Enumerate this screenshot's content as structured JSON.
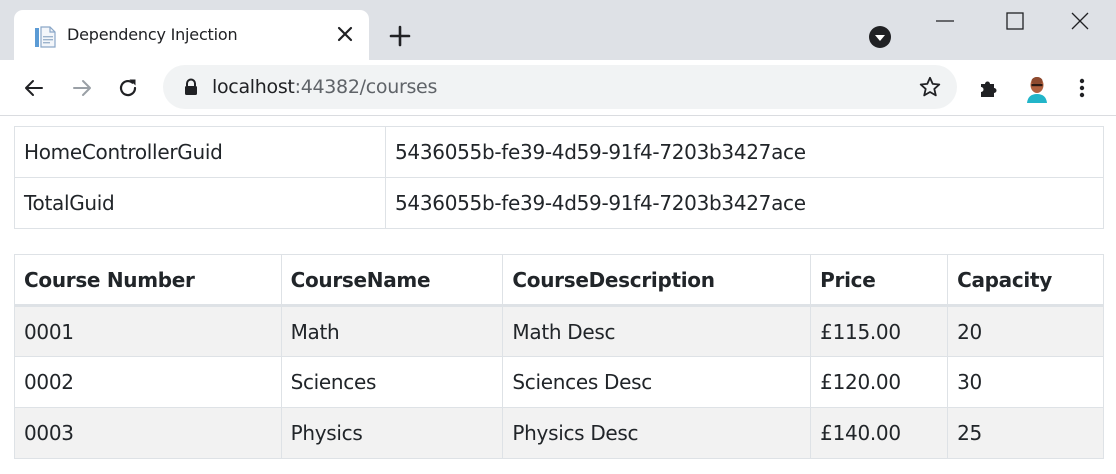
{
  "browser": {
    "tab_title": "Dependency Injection",
    "url_host": "localhost",
    "url_rest": ":44382/courses"
  },
  "guids": [
    {
      "key": "HomeControllerGuid",
      "value": "5436055b-fe39-4d59-91f4-7203b3427ace"
    },
    {
      "key": "TotalGuid",
      "value": "5436055b-fe39-4d59-91f4-7203b3427ace"
    }
  ],
  "courses": {
    "headers": [
      "Course Number",
      "CourseName",
      "CourseDescription",
      "Price",
      "Capacity"
    ],
    "rows": [
      [
        "0001",
        "Math",
        "Math Desc",
        "£115.00",
        "20"
      ],
      [
        "0002",
        "Sciences",
        "Sciences Desc",
        "£120.00",
        "30"
      ],
      [
        "0003",
        "Physics",
        "Physics Desc",
        "£140.00",
        "25"
      ]
    ]
  },
  "icons": {
    "favicon": "document-icon",
    "tab_close": "close-icon",
    "new_tab": "plus-icon",
    "profile_menu": "chevron-down-icon",
    "back": "arrow-left-icon",
    "forward": "arrow-right-icon",
    "reload": "reload-icon",
    "lock": "lock-icon",
    "bookmark": "star-icon",
    "extensions": "puzzle-icon",
    "menu": "kebab-icon"
  },
  "colors": {
    "chrome_bg": "#dee1e6",
    "omnibox_bg": "#f1f3f4",
    "table_border": "#dee2e6",
    "striped_row": "#f2f2f2",
    "text": "#212529"
  }
}
